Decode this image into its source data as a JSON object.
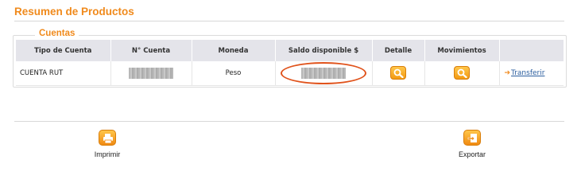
{
  "page": {
    "title": "Resumen de Productos"
  },
  "accounts": {
    "legend": "Cuentas",
    "columns": [
      "Tipo de Cuenta",
      "N° Cuenta",
      "Moneda",
      "Saldo disponible $",
      "Detalle",
      "Movimientos",
      ""
    ],
    "rows": [
      {
        "tipo": "CUENTA RUT",
        "numero": "",
        "moneda": "Peso",
        "saldo": "",
        "detalle_icon": "magnifier-icon",
        "movimientos_icon": "magnifier-icon",
        "transfer_label": "Transferir"
      }
    ]
  },
  "actions": {
    "print_label": "Imprimir",
    "export_label": "Exportar"
  },
  "colors": {
    "accent": "#f08a1c",
    "link": "#2a5d9e",
    "highlight": "#e0531c",
    "header_bg": "#e4e4ea"
  }
}
